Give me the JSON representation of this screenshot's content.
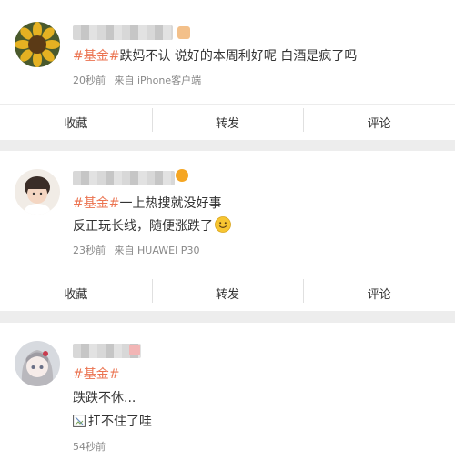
{
  "posts": [
    {
      "tag": "#基金#",
      "lines": [
        "跌妈不认 说好的本周利好呢 白酒是疯了吗"
      ],
      "time": "20秒前",
      "source": "来自 iPhone客户端",
      "actions": [
        "收藏",
        "转发",
        "评论"
      ]
    },
    {
      "tag": "#基金#",
      "lines": [
        "一上热搜就没好事",
        "反正玩长线，随便涨跌了"
      ],
      "time": "23秒前",
      "source": "来自 HUAWEI P30",
      "actions": [
        "收藏",
        "转发",
        "评论"
      ]
    },
    {
      "tag": "#基金#",
      "lines": [
        "",
        "跌跌不休...",
        "扛不住了哇"
      ],
      "time": "54秒前",
      "source": ""
    }
  ],
  "colors": {
    "tag": "#eb7350",
    "meta": "#888888",
    "background": "#ededed",
    "verify": "#f5a623"
  },
  "icons": [
    "sunflower-avatar",
    "baby-avatar",
    "anime-girl-avatar",
    "smile-emoji-icon",
    "broken-image-icon",
    "verified-badge-icon"
  ]
}
